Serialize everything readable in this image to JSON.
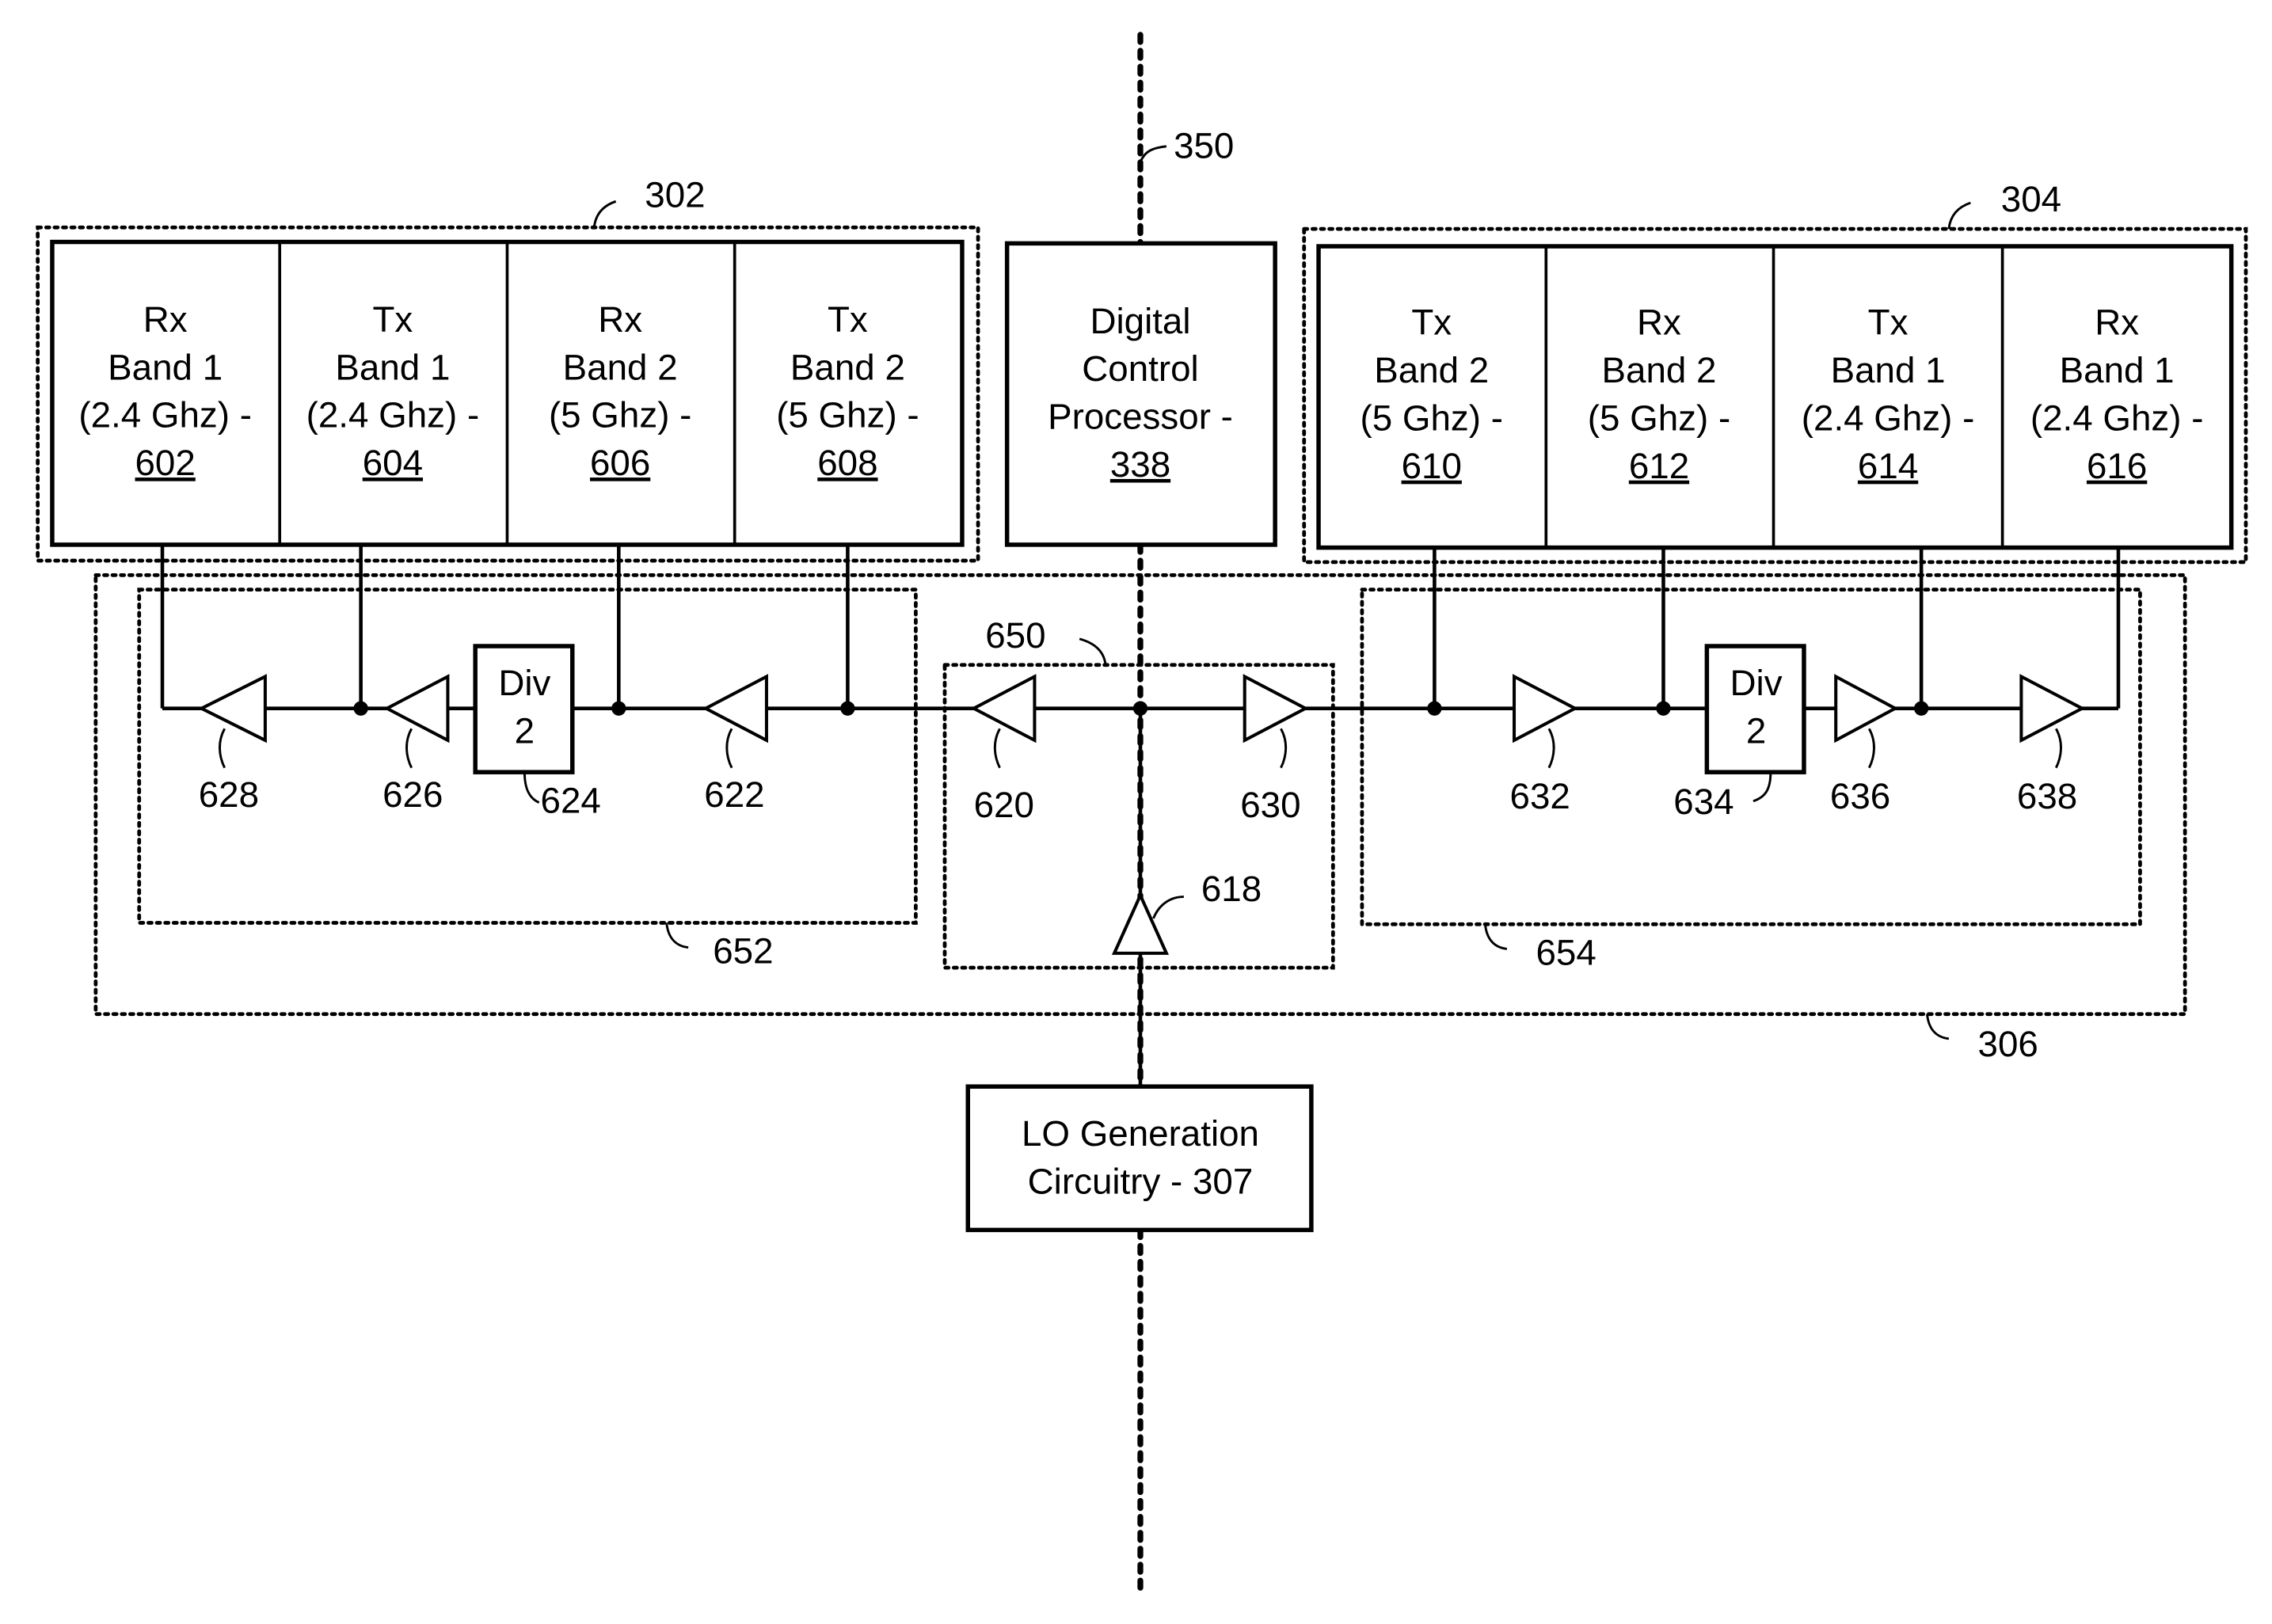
{
  "diagram": {
    "axis_label": "350",
    "group_302": {
      "ref": "302",
      "blocks": [
        {
          "l1": "Rx",
          "l2": "Band 1",
          "l3": "(2.4 Ghz) -",
          "num": "602"
        },
        {
          "l1": "Tx",
          "l2": "Band 1",
          "l3": "(2.4 Ghz) -",
          "num": "604"
        },
        {
          "l1": "Rx",
          "l2": "Band 2",
          "l3": "(5 Ghz) -",
          "num": "606"
        },
        {
          "l1": "Tx",
          "l2": "Band 2",
          "l3": "(5 Ghz) -",
          "num": "608"
        }
      ]
    },
    "dcp": {
      "l1": "Digital",
      "l2": "Control",
      "l3": "Processor -",
      "num": "338"
    },
    "group_304": {
      "ref": "304",
      "blocks": [
        {
          "l1": "Tx",
          "l2": "Band 2",
          "l3": "(5 Ghz) -",
          "num": "610"
        },
        {
          "l1": "Rx",
          "l2": "Band 2",
          "l3": "(5 Ghz) -",
          "num": "612"
        },
        {
          "l1": "Tx",
          "l2": "Band 1",
          "l3": "(2.4 Ghz) -",
          "num": "614"
        },
        {
          "l1": "Rx",
          "l2": "Band 1",
          "l3": "(2.4 Ghz) -",
          "num": "616"
        }
      ]
    },
    "distribution_ref": "306",
    "left_ref": "652",
    "center_ref": "650",
    "right_ref": "654",
    "divider_left": {
      "l1": "Div",
      "l2": "2",
      "ref": "624"
    },
    "divider_right": {
      "l1": "Div",
      "l2": "2",
      "ref": "634"
    },
    "amps": {
      "a628": "628",
      "a626": "626",
      "a622": "622",
      "a620": "620",
      "a630": "630",
      "a632": "632",
      "a636": "636",
      "a638": "638",
      "a618": "618"
    },
    "lo": {
      "l1": "LO Generation",
      "l2": "Circuitry - 307"
    }
  }
}
